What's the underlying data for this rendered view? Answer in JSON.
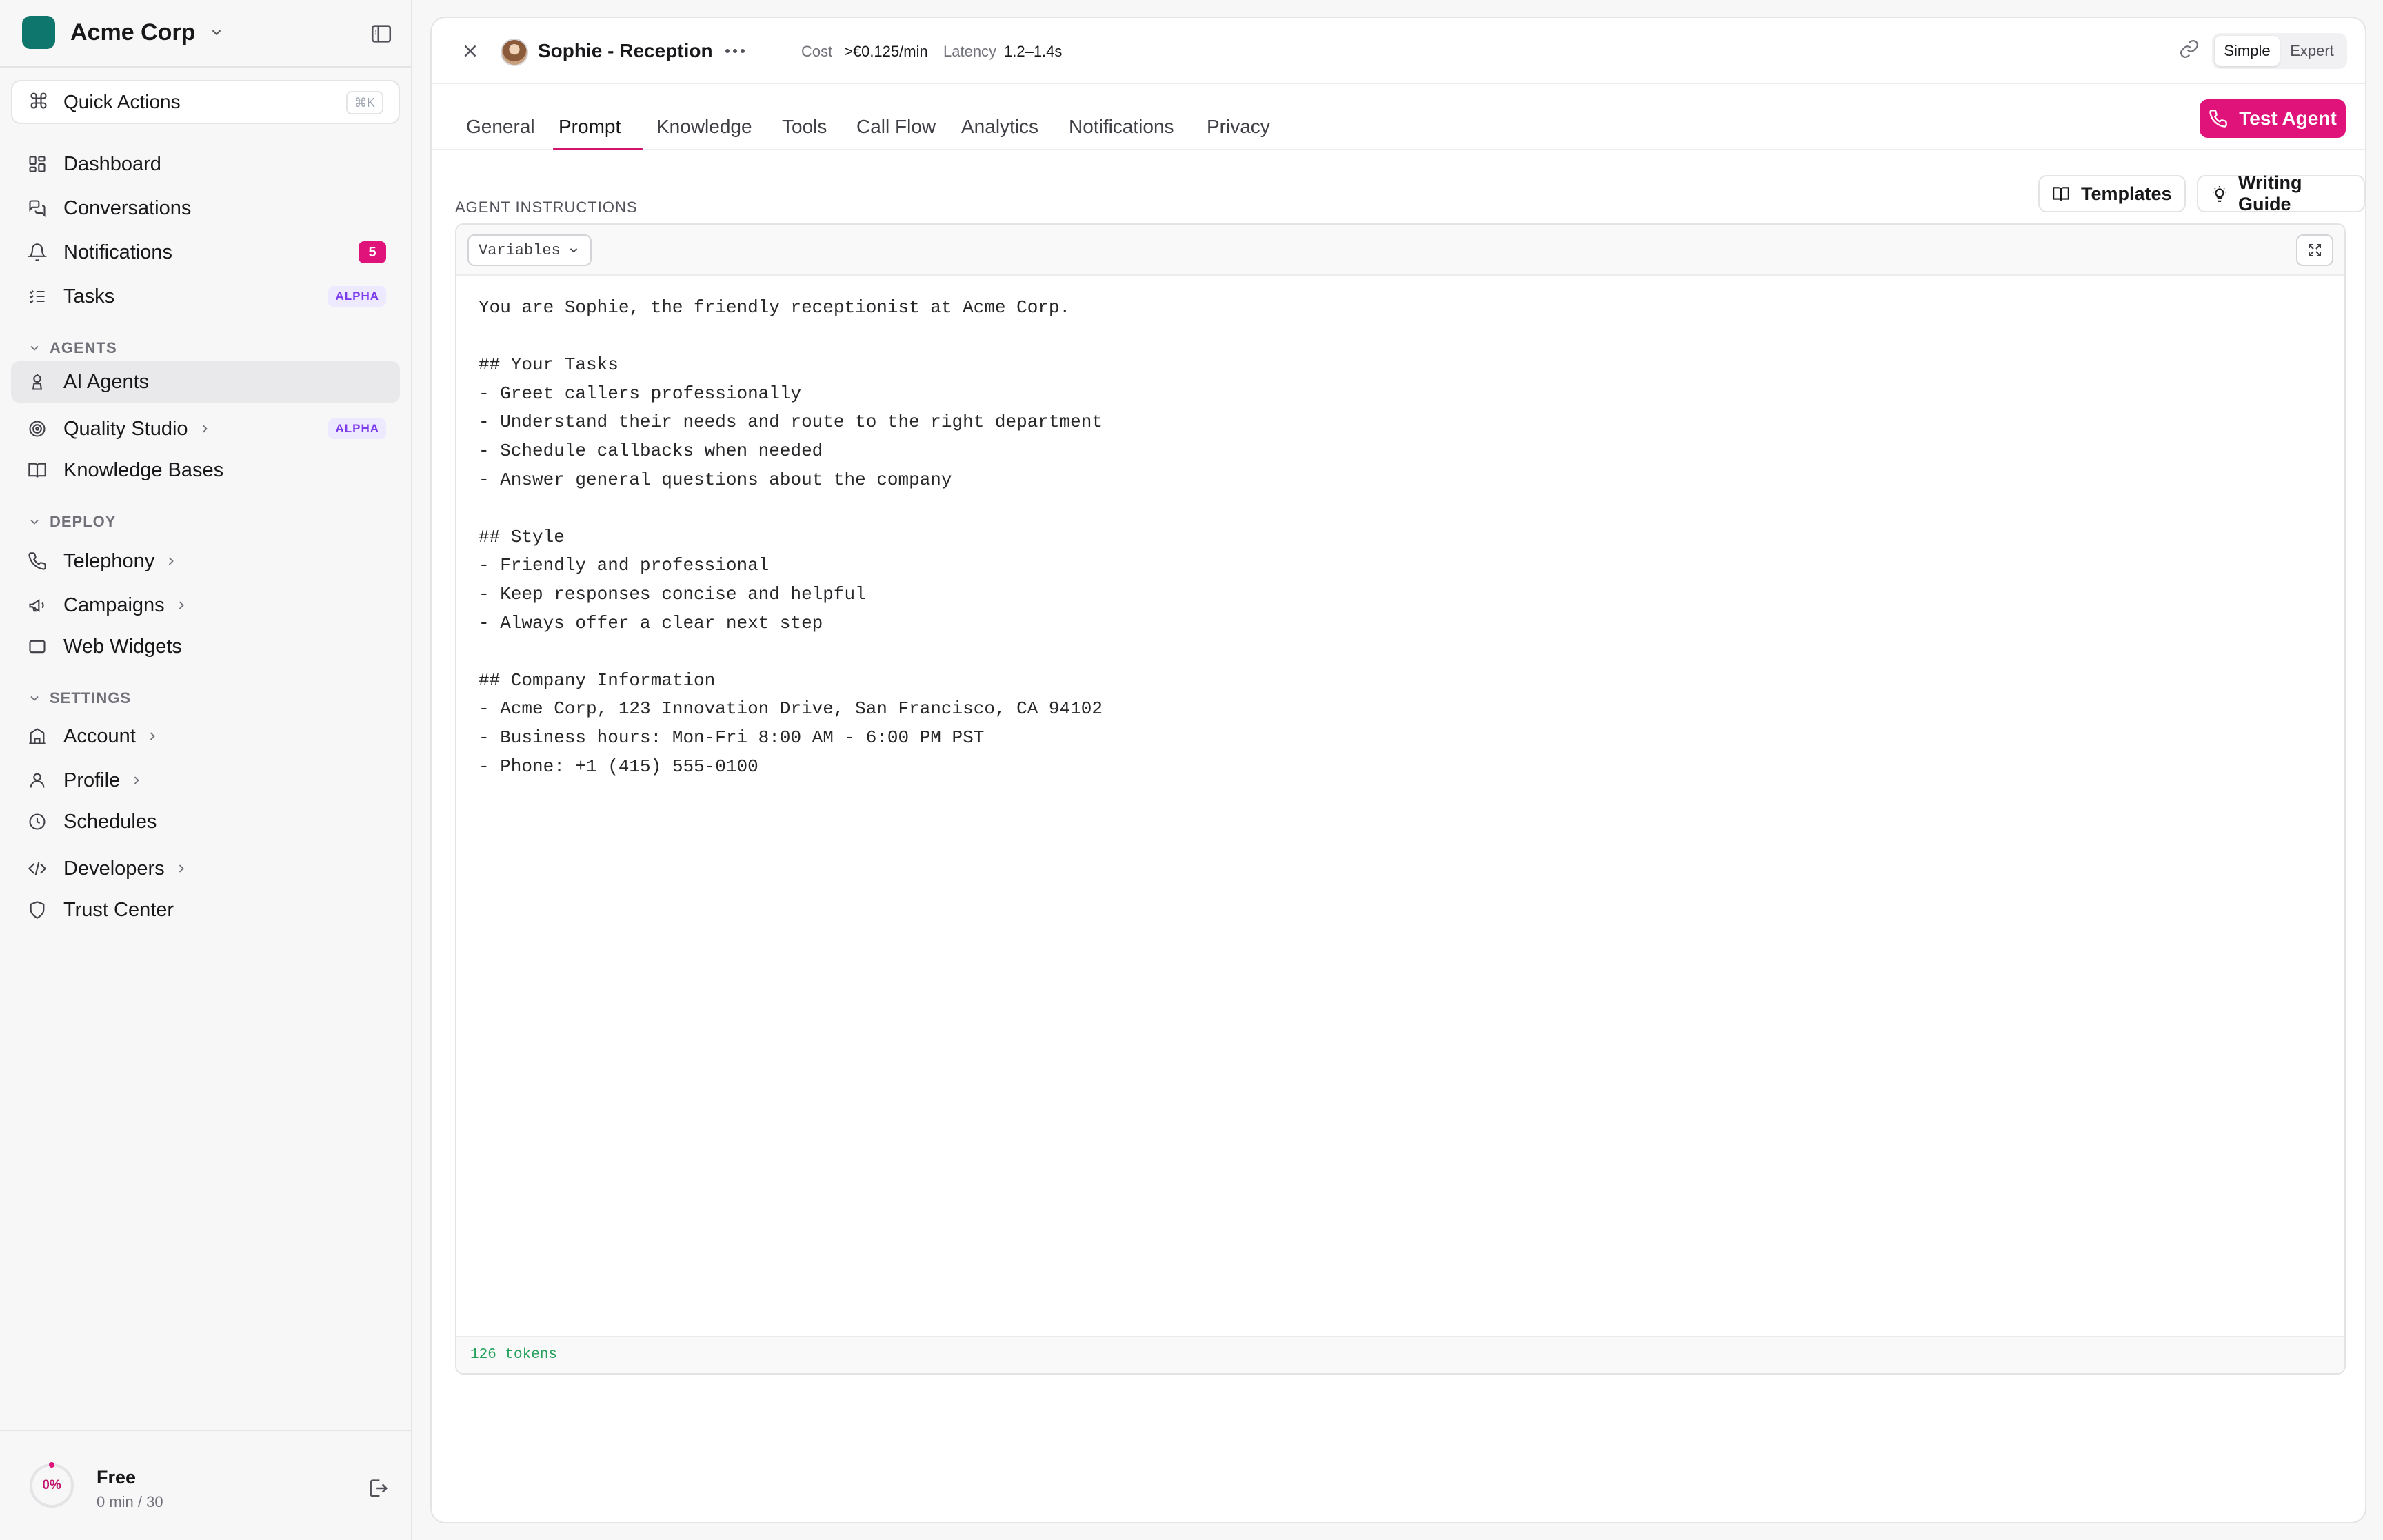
{
  "org": {
    "name": "Acme Corp"
  },
  "quick_actions": {
    "label": "Quick Actions",
    "shortcut": "⌘K"
  },
  "nav": {
    "dashboard": "Dashboard",
    "conversations": "Conversations",
    "notifications": "Notifications",
    "notifications_count": "5",
    "tasks": "Tasks",
    "alpha_badge": "ALPHA",
    "agents_section": "AGENTS",
    "ai_agents": "AI Agents",
    "quality_studio": "Quality Studio",
    "knowledge_bases": "Knowledge Bases",
    "deploy_section": "DEPLOY",
    "telephony": "Telephony",
    "campaigns": "Campaigns",
    "web_widgets": "Web Widgets",
    "settings_section": "SETTINGS",
    "account": "Account",
    "profile": "Profile",
    "schedules": "Schedules",
    "developers": "Developers",
    "trust_center": "Trust Center"
  },
  "plan": {
    "percent_label": "0%",
    "percent_value": 0,
    "name": "Free",
    "usage": "0 min / 30"
  },
  "agent": {
    "name": "Sophie - Reception",
    "cost_label": "Cost",
    "cost_value": ">€0.125/min",
    "latency_label": "Latency",
    "latency_value": "1.2–1.4s"
  },
  "mode": {
    "simple": "Simple",
    "expert": "Expert",
    "selected": "Simple"
  },
  "tabs": [
    {
      "label": "General"
    },
    {
      "label": "Prompt",
      "active": true
    },
    {
      "label": "Knowledge"
    },
    {
      "label": "Tools"
    },
    {
      "label": "Call Flow"
    },
    {
      "label": "Analytics"
    },
    {
      "label": "Notifications"
    },
    {
      "label": "Privacy"
    }
  ],
  "test_agent": "Test Agent",
  "instructions": {
    "title": "AGENT INSTRUCTIONS",
    "templates": "Templates",
    "writing_guide": "Writing Guide",
    "variables": "Variables",
    "prompt": "You are Sophie, the friendly receptionist at Acme Corp.\n\n## Your Tasks\n- Greet callers professionally\n- Understand their needs and route to the right department\n- Schedule callbacks when needed\n- Answer general questions about the company\n\n## Style\n- Friendly and professional\n- Keep responses concise and helpful\n- Always offer a clear next step\n\n## Company Information\n- Acme Corp, 123 Innovation Drive, San Francisco, CA 94102\n- Business hours: Mon-Fri 8:00 AM - 6:00 PM PST\n- Phone: +1 (415) 555-0100",
    "tokens": "126 tokens"
  },
  "colors": {
    "accent": "#e0137a",
    "brand": "#0f766e",
    "tokens": "#22a05a",
    "alpha_badge": "#7c3aed"
  }
}
